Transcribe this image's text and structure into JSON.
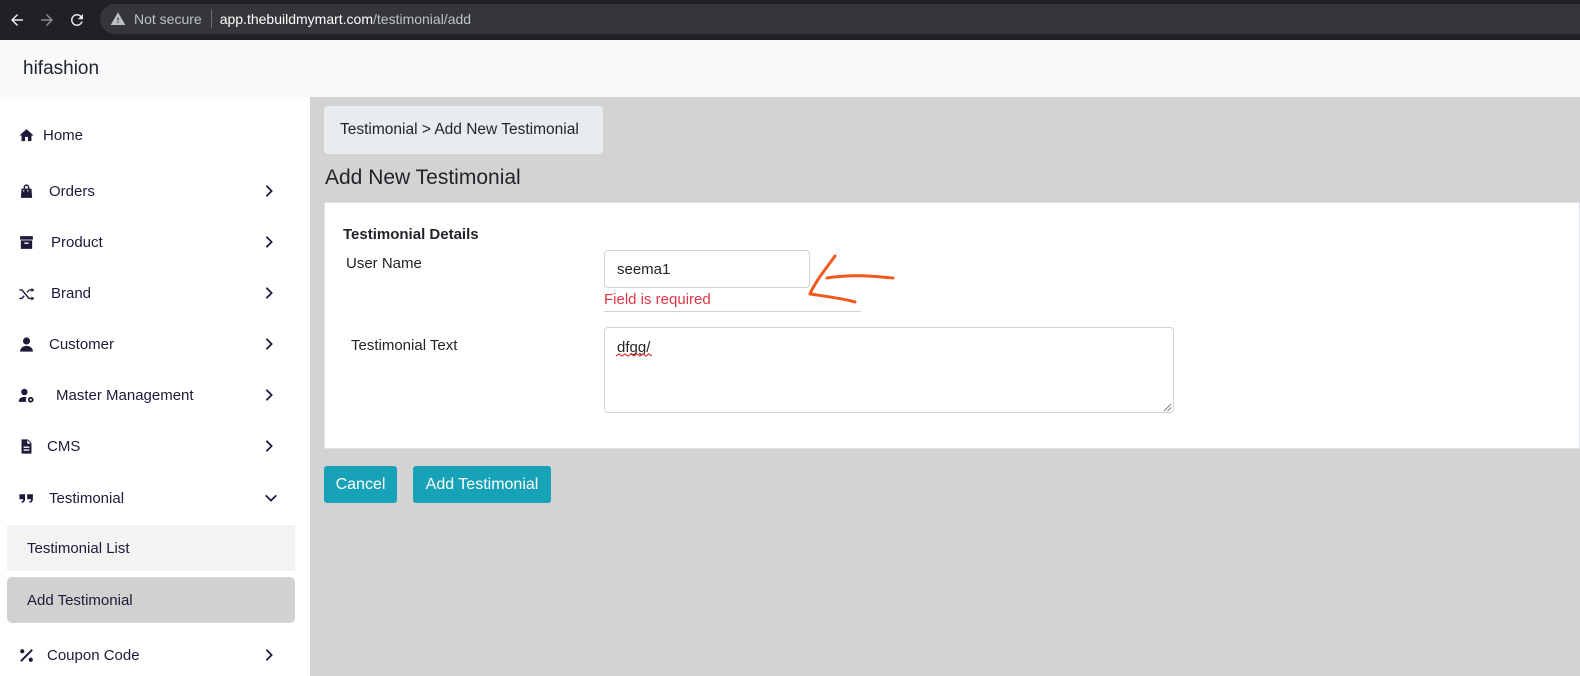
{
  "browser": {
    "security_label": "Not secure",
    "url_host": "app.thebuildmymart.com",
    "url_path": "/testimonial/add"
  },
  "app": {
    "brand": "hifashion"
  },
  "sidebar": {
    "items": [
      {
        "label": "Home",
        "icon": "home-icon"
      },
      {
        "label": "Orders",
        "icon": "shopping-bag-icon"
      },
      {
        "label": "Product",
        "icon": "archive-icon"
      },
      {
        "label": "Brand",
        "icon": "shuffle-icon"
      },
      {
        "label": "Customer",
        "icon": "user-icon"
      },
      {
        "label": "Master Management",
        "icon": "user-cog-icon"
      },
      {
        "label": "CMS",
        "icon": "file-icon"
      },
      {
        "label": "Testimonial",
        "icon": "quote-icon"
      },
      {
        "label": "Coupon Code",
        "icon": "percent-icon"
      }
    ],
    "sub_items": [
      {
        "label": "Testimonial List"
      },
      {
        "label": "Add Testimonial"
      }
    ]
  },
  "breadcrumb": {
    "text": "Testimonial > Add New Testimonial"
  },
  "page": {
    "title": "Add New Testimonial"
  },
  "form": {
    "section_title": "Testimonial Details",
    "user_name_label": "User Name",
    "user_name_value": "seema1",
    "user_name_error": "Field is required",
    "testimonial_text_label": "Testimonial Text",
    "testimonial_text_value": "dfgg/"
  },
  "actions": {
    "cancel_label": "Cancel",
    "add_label": "Add Testimonial"
  },
  "colors": {
    "accent": "#17a2b8",
    "error": "#dc3545",
    "annotation": "#f05a1e"
  }
}
